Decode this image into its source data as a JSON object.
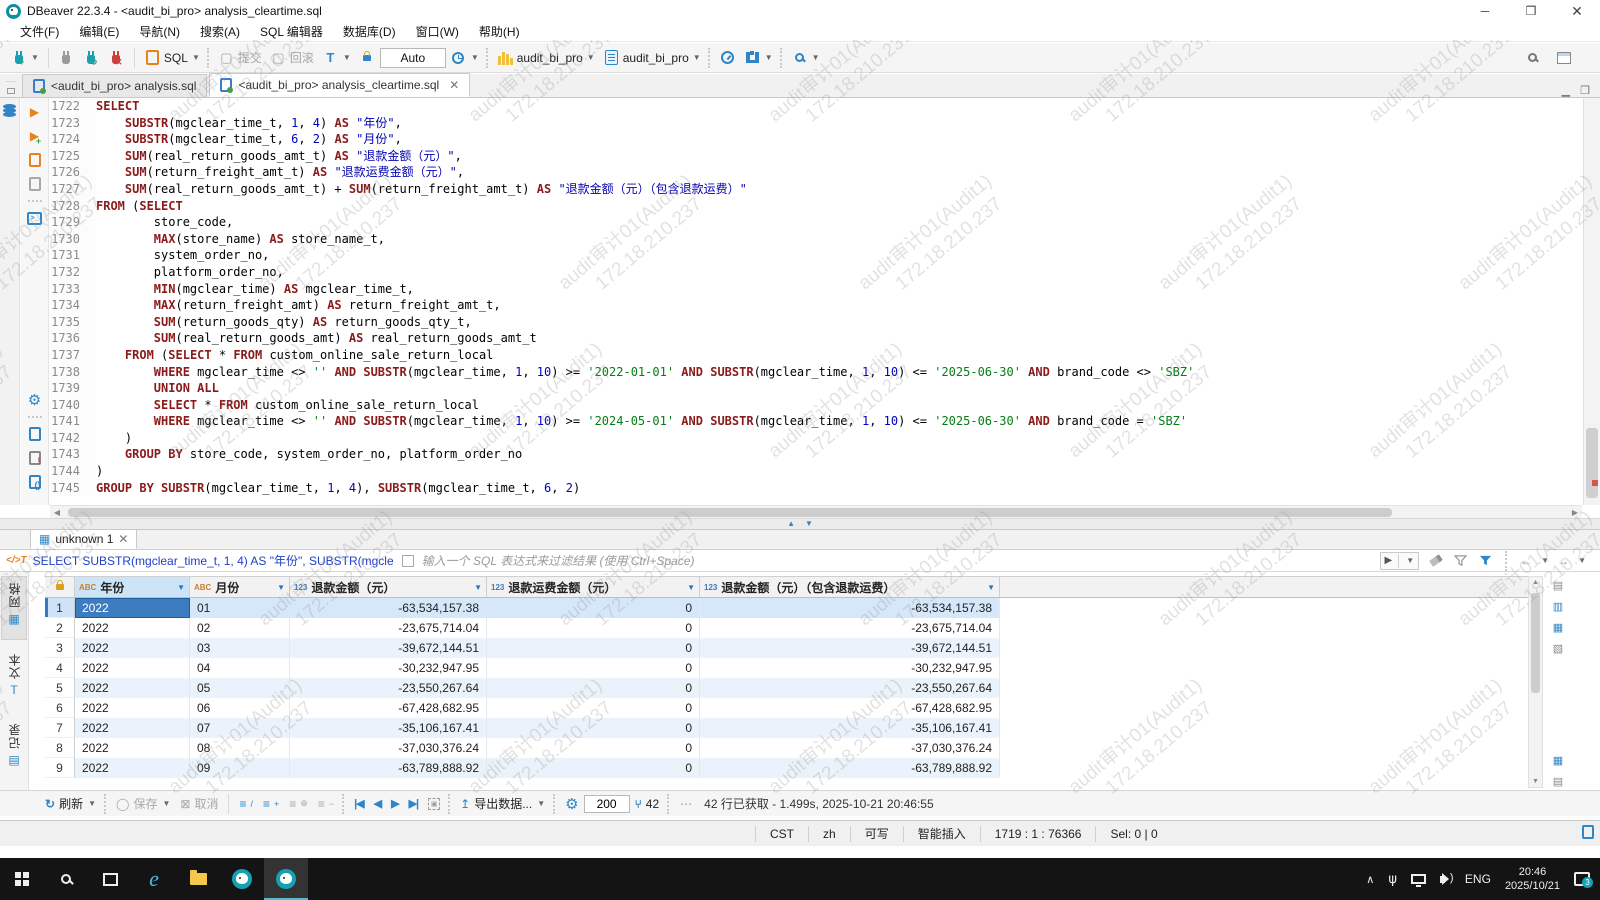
{
  "window": {
    "title": "DBeaver 22.3.4 - <audit_bi_pro> analysis_cleartime.sql"
  },
  "menu": {
    "items": [
      "文件(F)",
      "编辑(E)",
      "导航(N)",
      "搜索(A)",
      "SQL 编辑器",
      "数据库(D)",
      "窗口(W)",
      "帮助(H)"
    ]
  },
  "toolbar": {
    "sql_label": "SQL",
    "commit_label": "提交",
    "rollback_label": "回滚",
    "tx_mode": "Auto",
    "database": "audit_bi_pro",
    "schema": "audit_bi_pro"
  },
  "editor_tabs": [
    {
      "label": "<audit_bi_pro> analysis.sql",
      "active": false
    },
    {
      "label": "<audit_bi_pro> analysis_cleartime.sql",
      "active": true
    }
  ],
  "editor": {
    "watermark_line1": "audit审计01(Audit1)",
    "watermark_line2": "172.18.210.237",
    "lines": [
      {
        "no": "1722",
        "segs": [
          [
            "SELECT",
            "k"
          ]
        ]
      },
      {
        "no": "1723",
        "segs": [
          [
            "    ",
            "p"
          ],
          [
            "SUBSTR",
            "k"
          ],
          [
            "(mgclear_time_t, ",
            "p"
          ],
          [
            "1",
            "n"
          ],
          [
            ", ",
            "p"
          ],
          [
            "4",
            "n"
          ],
          [
            ") ",
            "p"
          ],
          [
            "AS",
            "k"
          ],
          [
            " ",
            "p"
          ],
          [
            "\"年份\"",
            "q"
          ],
          [
            ",",
            "p"
          ]
        ]
      },
      {
        "no": "1724",
        "segs": [
          [
            "    ",
            "p"
          ],
          [
            "SUBSTR",
            "k"
          ],
          [
            "(mgclear_time_t, ",
            "p"
          ],
          [
            "6",
            "n"
          ],
          [
            ", ",
            "p"
          ],
          [
            "2",
            "n"
          ],
          [
            ") ",
            "p"
          ],
          [
            "AS",
            "k"
          ],
          [
            " ",
            "p"
          ],
          [
            "\"月份\"",
            "q"
          ],
          [
            ",",
            "p"
          ]
        ]
      },
      {
        "no": "1725",
        "segs": [
          [
            "    ",
            "p"
          ],
          [
            "SUM",
            "k"
          ],
          [
            "(real_return_goods_amt_t) ",
            "p"
          ],
          [
            "AS",
            "k"
          ],
          [
            " ",
            "p"
          ],
          [
            "\"退款金额（元）\"",
            "q"
          ],
          [
            ",",
            "p"
          ]
        ]
      },
      {
        "no": "1726",
        "segs": [
          [
            "    ",
            "p"
          ],
          [
            "SUM",
            "k"
          ],
          [
            "(return_freight_amt_t) ",
            "p"
          ],
          [
            "AS",
            "k"
          ],
          [
            " ",
            "p"
          ],
          [
            "\"退款运费金额（元）\"",
            "q"
          ],
          [
            ",",
            "p"
          ]
        ]
      },
      {
        "no": "1727",
        "segs": [
          [
            "    ",
            "p"
          ],
          [
            "SUM",
            "k"
          ],
          [
            "(real_return_goods_amt_t) + ",
            "p"
          ],
          [
            "SUM",
            "k"
          ],
          [
            "(return_freight_amt_t) ",
            "p"
          ],
          [
            "AS",
            "k"
          ],
          [
            " ",
            "p"
          ],
          [
            "\"退款金额（元）（包含退款运费）\"",
            "q"
          ]
        ]
      },
      {
        "no": "1728",
        "segs": [
          [
            "FROM",
            "k"
          ],
          [
            " (",
            "p"
          ],
          [
            "SELECT",
            "k"
          ]
        ]
      },
      {
        "no": "1729",
        "segs": [
          [
            "        store_code,",
            "p"
          ]
        ]
      },
      {
        "no": "1730",
        "segs": [
          [
            "        ",
            "p"
          ],
          [
            "MAX",
            "k"
          ],
          [
            "(store_name) ",
            "p"
          ],
          [
            "AS",
            "k"
          ],
          [
            " store_name_t,",
            "p"
          ]
        ]
      },
      {
        "no": "1731",
        "segs": [
          [
            "        system_order_no,",
            "p"
          ]
        ]
      },
      {
        "no": "1732",
        "segs": [
          [
            "        platform_order_no,",
            "p"
          ]
        ]
      },
      {
        "no": "1733",
        "segs": [
          [
            "        ",
            "p"
          ],
          [
            "MIN",
            "k"
          ],
          [
            "(mgclear_time) ",
            "p"
          ],
          [
            "AS",
            "k"
          ],
          [
            " mgclear_time_t,",
            "p"
          ]
        ]
      },
      {
        "no": "1734",
        "segs": [
          [
            "        ",
            "p"
          ],
          [
            "MAX",
            "k"
          ],
          [
            "(return_freight_amt) ",
            "p"
          ],
          [
            "AS",
            "k"
          ],
          [
            " return_freight_amt_t,",
            "p"
          ]
        ]
      },
      {
        "no": "1735",
        "segs": [
          [
            "        ",
            "p"
          ],
          [
            "SUM",
            "k"
          ],
          [
            "(return_goods_qty) ",
            "p"
          ],
          [
            "AS",
            "k"
          ],
          [
            " return_goods_qty_t,",
            "p"
          ]
        ]
      },
      {
        "no": "1736",
        "segs": [
          [
            "        ",
            "p"
          ],
          [
            "SUM",
            "k"
          ],
          [
            "(real_return_goods_amt) ",
            "p"
          ],
          [
            "AS",
            "k"
          ],
          [
            " real_return_goods_amt_t",
            "p"
          ]
        ]
      },
      {
        "no": "1737",
        "segs": [
          [
            "    ",
            "p"
          ],
          [
            "FROM",
            "k"
          ],
          [
            " (",
            "p"
          ],
          [
            "SELECT",
            "k"
          ],
          [
            " * ",
            "p"
          ],
          [
            "FROM",
            "k"
          ],
          [
            " custom_online_sale_return_local",
            "p"
          ]
        ]
      },
      {
        "no": "1738",
        "segs": [
          [
            "        ",
            "p"
          ],
          [
            "WHERE",
            "k"
          ],
          [
            " mgclear_time <> ",
            "p"
          ],
          [
            "''",
            "s"
          ],
          [
            " ",
            "p"
          ],
          [
            "AND",
            "k"
          ],
          [
            " ",
            "p"
          ],
          [
            "SUBSTR",
            "k"
          ],
          [
            "(mgclear_time, ",
            "p"
          ],
          [
            "1",
            "n"
          ],
          [
            ", ",
            "p"
          ],
          [
            "10",
            "n"
          ],
          [
            ") >= ",
            "p"
          ],
          [
            "'2022-01-01'",
            "s"
          ],
          [
            " ",
            "p"
          ],
          [
            "AND",
            "k"
          ],
          [
            " ",
            "p"
          ],
          [
            "SUBSTR",
            "k"
          ],
          [
            "(mgclear_time, ",
            "p"
          ],
          [
            "1",
            "n"
          ],
          [
            ", ",
            "p"
          ],
          [
            "10",
            "n"
          ],
          [
            ") <= ",
            "p"
          ],
          [
            "'2025-06-30'",
            "s"
          ],
          [
            " ",
            "p"
          ],
          [
            "AND",
            "k"
          ],
          [
            " brand_code <> ",
            "p"
          ],
          [
            "'SBZ'",
            "s"
          ]
        ]
      },
      {
        "no": "1739",
        "segs": [
          [
            "        ",
            "p"
          ],
          [
            "UNION ALL",
            "k"
          ]
        ]
      },
      {
        "no": "1740",
        "segs": [
          [
            "        ",
            "p"
          ],
          [
            "SELECT",
            "k"
          ],
          [
            " * ",
            "p"
          ],
          [
            "FROM",
            "k"
          ],
          [
            " custom_online_sale_return_local",
            "p"
          ]
        ]
      },
      {
        "no": "1741",
        "segs": [
          [
            "        ",
            "p"
          ],
          [
            "WHERE",
            "k"
          ],
          [
            " mgclear_time <> ",
            "p"
          ],
          [
            "''",
            "s"
          ],
          [
            " ",
            "p"
          ],
          [
            "AND",
            "k"
          ],
          [
            " ",
            "p"
          ],
          [
            "SUBSTR",
            "k"
          ],
          [
            "(mgclear_time, ",
            "p"
          ],
          [
            "1",
            "n"
          ],
          [
            ", ",
            "p"
          ],
          [
            "10",
            "n"
          ],
          [
            ") >= ",
            "p"
          ],
          [
            "'2024-05-01'",
            "s"
          ],
          [
            " ",
            "p"
          ],
          [
            "AND",
            "k"
          ],
          [
            " ",
            "p"
          ],
          [
            "SUBSTR",
            "k"
          ],
          [
            "(mgclear_time, ",
            "p"
          ],
          [
            "1",
            "n"
          ],
          [
            ", ",
            "p"
          ],
          [
            "10",
            "n"
          ],
          [
            ") <= ",
            "p"
          ],
          [
            "'2025-06-30'",
            "s"
          ],
          [
            " ",
            "p"
          ],
          [
            "AND",
            "k"
          ],
          [
            " brand_code = ",
            "p"
          ],
          [
            "'SBZ'",
            "s"
          ]
        ]
      },
      {
        "no": "1742",
        "segs": [
          [
            "    )",
            "p"
          ]
        ]
      },
      {
        "no": "1743",
        "segs": [
          [
            "    ",
            "p"
          ],
          [
            "GROUP BY",
            "k"
          ],
          [
            " store_code, system_order_no, platform_order_no",
            "p"
          ]
        ]
      },
      {
        "no": "1744",
        "segs": [
          [
            ")",
            "p"
          ]
        ]
      },
      {
        "no": "1745",
        "segs": [
          [
            "GROUP BY",
            "k"
          ],
          [
            " ",
            "p"
          ],
          [
            "SUBSTR",
            "k"
          ],
          [
            "(mgclear_time_t, ",
            "p"
          ],
          [
            "1",
            "n"
          ],
          [
            ", ",
            "p"
          ],
          [
            "4",
            "n"
          ],
          [
            "), ",
            "p"
          ],
          [
            "SUBSTR",
            "k"
          ],
          [
            "(mgclear_time_t, ",
            "p"
          ],
          [
            "6",
            "n"
          ],
          [
            ", ",
            "p"
          ],
          [
            "2",
            "n"
          ],
          [
            ")",
            "p"
          ]
        ]
      }
    ]
  },
  "results": {
    "tab_label": "unknown 1",
    "filter": {
      "query": "SELECT SUBSTR(mgclear_time_t, 1, 4) AS \"年份\", SUBSTR(mgcle",
      "placeholder": "输入一个 SQL 表达式来过滤结果 (使用 Ctrl+Space)"
    },
    "side_tabs": [
      "网格",
      "文本",
      "记录"
    ],
    "table": {
      "columns": [
        {
          "type": "ABC",
          "name": "年份",
          "selected": true
        },
        {
          "type": "ABC",
          "name": "月份",
          "selected": false
        },
        {
          "type": "123",
          "name": "退款金额（元）",
          "selected": false
        },
        {
          "type": "123",
          "name": "退款运费金额（元）",
          "selected": false
        },
        {
          "type": "123",
          "name": "退款金额（元）（包含退款运费）",
          "selected": false
        }
      ],
      "rows": [
        [
          "2022",
          "01",
          "-63,534,157.38",
          "0",
          "-63,534,157.38"
        ],
        [
          "2022",
          "02",
          "-23,675,714.04",
          "0",
          "-23,675,714.04"
        ],
        [
          "2022",
          "03",
          "-39,672,144.51",
          "0",
          "-39,672,144.51"
        ],
        [
          "2022",
          "04",
          "-30,232,947.95",
          "0",
          "-30,232,947.95"
        ],
        [
          "2022",
          "05",
          "-23,550,267.64",
          "0",
          "-23,550,267.64"
        ],
        [
          "2022",
          "06",
          "-67,428,682.95",
          "0",
          "-67,428,682.95"
        ],
        [
          "2022",
          "07",
          "-35,106,167.41",
          "0",
          "-35,106,167.41"
        ],
        [
          "2022",
          "08",
          "-37,030,376.24",
          "0",
          "-37,030,376.24"
        ],
        [
          "2022",
          "09",
          "-63,789,888.92",
          "0",
          "-63,789,888.92"
        ]
      ]
    },
    "toolbar": {
      "refresh": "刷新",
      "save": "保存",
      "cancel": "取消",
      "export": "导出数据...",
      "fetch_size": "200",
      "fetch_badge": "42",
      "status": "42 行已获取 - 1.499s, 2025-10-21 20:46:55"
    }
  },
  "statusbar": {
    "items": [
      "CST",
      "zh",
      "可写",
      "智能插入",
      "1719 : 1 : 76366",
      "Sel: 0 | 0"
    ]
  },
  "taskbar": {
    "lang": "ENG",
    "time": "20:46",
    "date": "2025/10/21",
    "notification_count": "3"
  }
}
